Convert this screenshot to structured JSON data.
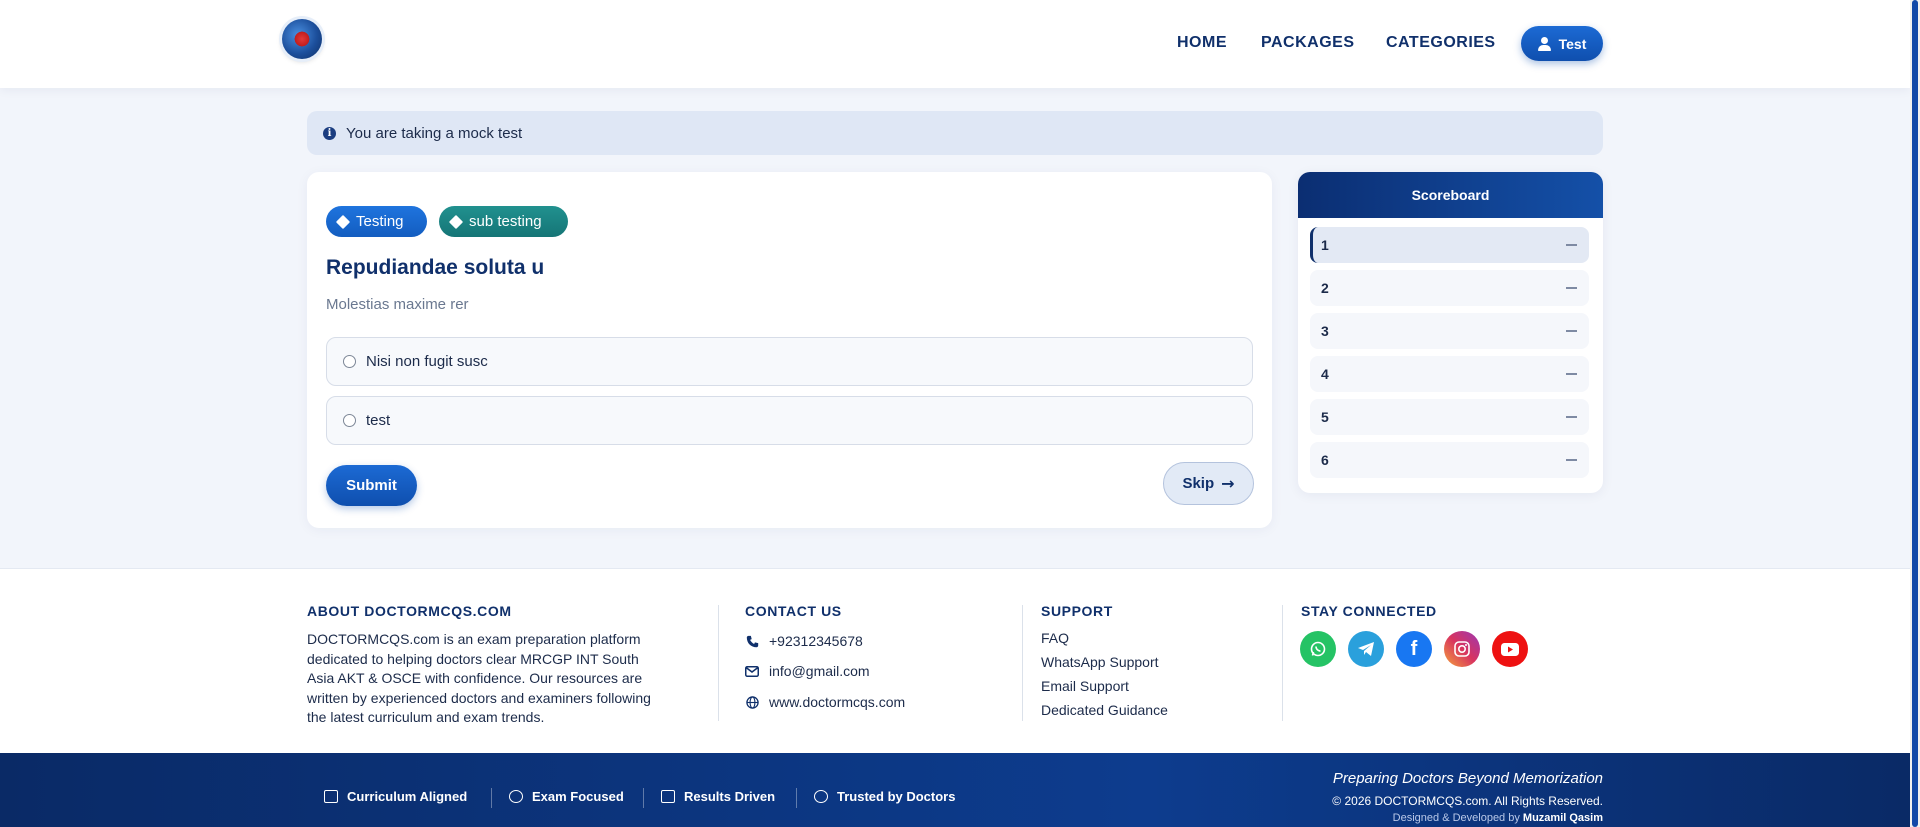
{
  "header": {
    "nav": {
      "home": "HOME",
      "packages": "PACKAGES",
      "categories": "CATEGORIES"
    },
    "user_button": "Test"
  },
  "alert": {
    "text": "You are taking a mock test"
  },
  "question": {
    "tags": [
      "Testing",
      "sub testing"
    ],
    "title": "Repudiandae soluta u",
    "subtitle": "Molestias maxime rer",
    "options": [
      "Nisi non fugit susc",
      "test"
    ],
    "submit_label": "Submit",
    "skip_label": "Skip"
  },
  "scoreboard": {
    "title": "Scoreboard",
    "items": [
      {
        "number": "1",
        "active": true
      },
      {
        "number": "2",
        "active": false
      },
      {
        "number": "3",
        "active": false
      },
      {
        "number": "4",
        "active": false
      },
      {
        "number": "5",
        "active": false
      },
      {
        "number": "6",
        "active": false
      }
    ]
  },
  "footer": {
    "about": {
      "heading": "ABOUT DOCTORMCQS.COM",
      "text": "DOCTORMCQS.com is an exam preparation platform dedicated to helping doctors clear MRCGP INT South Asia AKT & OSCE with confidence. Our resources are written by experienced doctors and examiners following the latest curriculum and exam trends."
    },
    "contact": {
      "heading": "CONTACT US",
      "phone": "+92312345678",
      "email": "info@gmail.com",
      "website": "www.doctormcqs.com"
    },
    "support": {
      "heading": "SUPPORT",
      "links": [
        "FAQ",
        "WhatsApp Support",
        "Email Support",
        "Dedicated Guidance"
      ]
    },
    "social": {
      "heading": "STAY CONNECTED",
      "icons": [
        "whatsapp-icon",
        "telegram-icon",
        "facebook-icon",
        "instagram-icon",
        "youtube-icon"
      ]
    }
  },
  "bottom_bar": {
    "features": [
      "Curriculum Aligned",
      "Exam Focused",
      "Results Driven",
      "Trusted by Doctors"
    ],
    "tagline": "Preparing Doctors Beyond Memorization",
    "copyright": "© 2026 DOCTORMCQS.com. All Rights Reserved.",
    "credit_prefix": "Designed & Developed by",
    "credit_name": "Muzamil Qasim"
  },
  "colors": {
    "primary": "#10306b",
    "accent_blue": "#1c6ad4",
    "teal": "#157576",
    "footer_bar": "#0a2a66"
  }
}
